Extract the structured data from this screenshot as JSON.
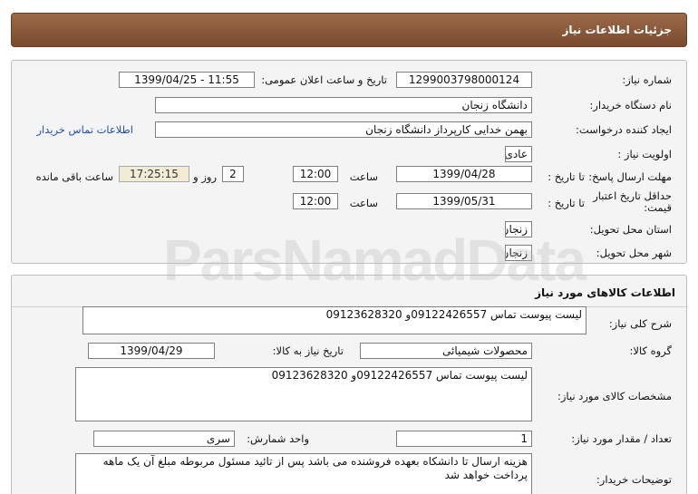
{
  "header": {
    "title": "جزئیات اطلاعات نیاز"
  },
  "need_info": {
    "need_number_label": "شماره نیاز:",
    "need_number": "1299003798000124",
    "announce_label": "تاریخ و ساعت اعلان عمومی:",
    "announce_value": "1399/04/25 - 11:55",
    "buyer_org_label": "نام دستگاه خریدار:",
    "buyer_org": "دانشگاه زنجان",
    "requester_label": "ایجاد کننده درخواست:",
    "requester": "بهمن خدایی کارپرداز دانشگاه زنجان",
    "contact_link": "اطلاعات تماس خریدار",
    "priority_label": "اولویت نیاز :",
    "priority": "عادی",
    "deadline_label": "مهلت ارسال پاسخ:",
    "until_date_label": "تا تاریخ :",
    "deadline_date": "1399/04/28",
    "time_label": "ساعت",
    "deadline_time": "12:00",
    "days_value": "2",
    "days_label": "روز و",
    "remaining_time": "17:25:15",
    "remaining_label": "ساعت باقی مانده",
    "validity_label": "حداقل تاریخ اعتبار قیمت:",
    "validity_until_label": "تا تاریخ :",
    "validity_date": "1399/05/31",
    "validity_time_label": "ساعت",
    "validity_time": "12:00",
    "province_label": "استان محل تحویل:",
    "province": "زنجان",
    "city_label": "شهر محل تحویل:",
    "city": "زنجان"
  },
  "goods_info": {
    "section_title": "اطلاعات کالاهای مورد نیاز",
    "summary_label": "شرح کلی نیاز:",
    "summary": "لیست پیوست تماس 09122426557و 09123628320",
    "group_label": "گروه کالا:",
    "group": "محصولات شیمیائی",
    "need_date_label": "تاریخ نیاز به کالا:",
    "need_date": "1399/04/29",
    "specs_label": "مشخصات کالای مورد نیاز:",
    "specs": "لیست پیوست تماس 09122426557و 09123628320",
    "quantity_label": "تعداد / مقدار مورد نیاز:",
    "quantity": "1",
    "unit_label": "واحد شمارش:",
    "unit": "سری",
    "buyer_notes_label": "توضیحات خریدار:",
    "buyer_notes": "هزینه ارسال تا دانشکاه بعهده فروشنده می باشد پس از تائید مسئول مربوطه مبلغ آن یک ماهه پرداخت خواهد شد"
  },
  "watermark": "ParsNamadData"
}
